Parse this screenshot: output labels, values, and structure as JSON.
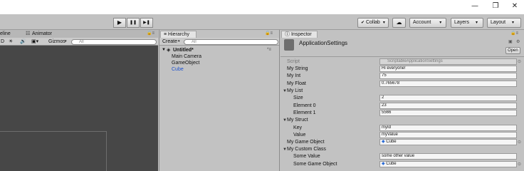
{
  "window": {
    "minimize": "—",
    "maximize": "❐",
    "close": "✕"
  },
  "toolbar": {
    "play": "▶",
    "pause": "❚❚",
    "step": "▶❚",
    "collab": "Collab",
    "account": "Account",
    "layers": "Layers",
    "layout": "Layout",
    "cloud": "☁"
  },
  "scene": {
    "tabs": [
      "eline",
      "Animator"
    ],
    "bar": {
      "mode": "D",
      "gizmos": "Gizmos",
      "search": "All"
    }
  },
  "hierarchy": {
    "tab": "Hierarchy",
    "create": "Create",
    "search": "All",
    "scene_name": "Untitled*",
    "items": [
      "Main Camera",
      "GameObject",
      "Cube"
    ]
  },
  "inspector": {
    "tab": "Inspector",
    "object_name": "ApplicationSettings",
    "open": "Open",
    "rows": [
      {
        "label": "Script",
        "value": "ScriptableApplicationSettings"
      },
      {
        "label": "My String",
        "value": "Hi everyone!"
      },
      {
        "label": "My Int",
        "value": "75"
      },
      {
        "label": "My Float",
        "value": "0.765678"
      },
      {
        "label": "My List",
        "value": ""
      },
      {
        "label": "Size",
        "value": "2"
      },
      {
        "label": "Element 0",
        "value": "23"
      },
      {
        "label": "Element 1",
        "value": "5566"
      },
      {
        "label": "My Struct",
        "value": ""
      },
      {
        "label": "Key",
        "value": "myId"
      },
      {
        "label": "Value",
        "value": "myValue"
      },
      {
        "label": "My Game Object",
        "value": "Cube"
      },
      {
        "label": "My Custom Class",
        "value": ""
      },
      {
        "label": "Some Value",
        "value": "some other value"
      },
      {
        "label": "Some Game Object",
        "value": "Cube"
      }
    ]
  },
  "colors": {
    "selected_item": "#1a4fcf",
    "scene_bg": "#474747",
    "panel_bg": "#c2c2c2"
  }
}
